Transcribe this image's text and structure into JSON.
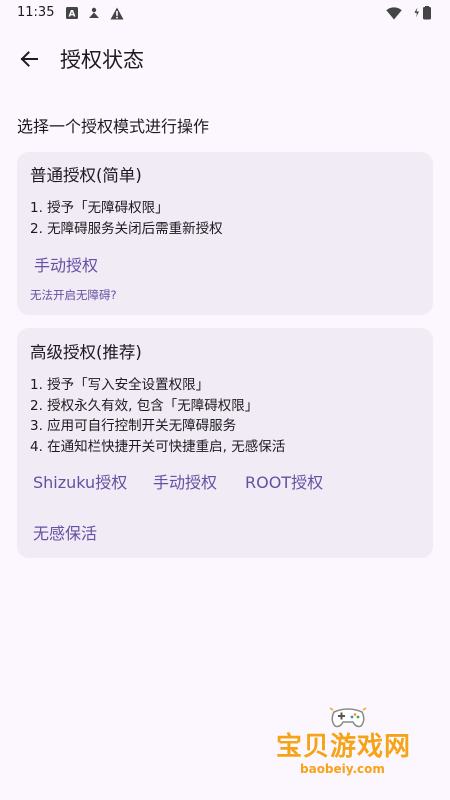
{
  "status_bar": {
    "time": "11:35",
    "icons": [
      "font-icon",
      "person-icon",
      "warning-icon",
      "wifi-icon",
      "battery-icon"
    ]
  },
  "app_bar": {
    "back_icon": "arrow-left-icon",
    "title": "授权状态"
  },
  "subtitle": "选择一个授权模式进行操作",
  "cards": {
    "normal": {
      "title": "普通授权(简单)",
      "steps": [
        "1. 授予「无障碍权限」",
        "2. 无障碍服务关闭后需重新授权"
      ],
      "button": "手动授权",
      "help_link": "无法开启无障碍?"
    },
    "advanced": {
      "title": "高级授权(推荐)",
      "steps": [
        "1. 授予「写入安全设置权限」",
        "2. 授权永久有效, 包含「无障碍权限」",
        "3. 应用可自行控制开关无障碍服务",
        "4. 在通知栏快捷开关可快捷重启, 无感保活"
      ],
      "buttons": [
        "Shizuku授权",
        "手动授权",
        "ROOT授权",
        "无感保活"
      ]
    }
  },
  "watermark": {
    "text": "宝贝游戏网",
    "url": "baobeiy.com"
  },
  "colors": {
    "background": "#FCF7FE",
    "card": "#F0EBF4",
    "accent": "#6750A4",
    "text": "#1D1B20",
    "watermark": "#F7A21B"
  }
}
